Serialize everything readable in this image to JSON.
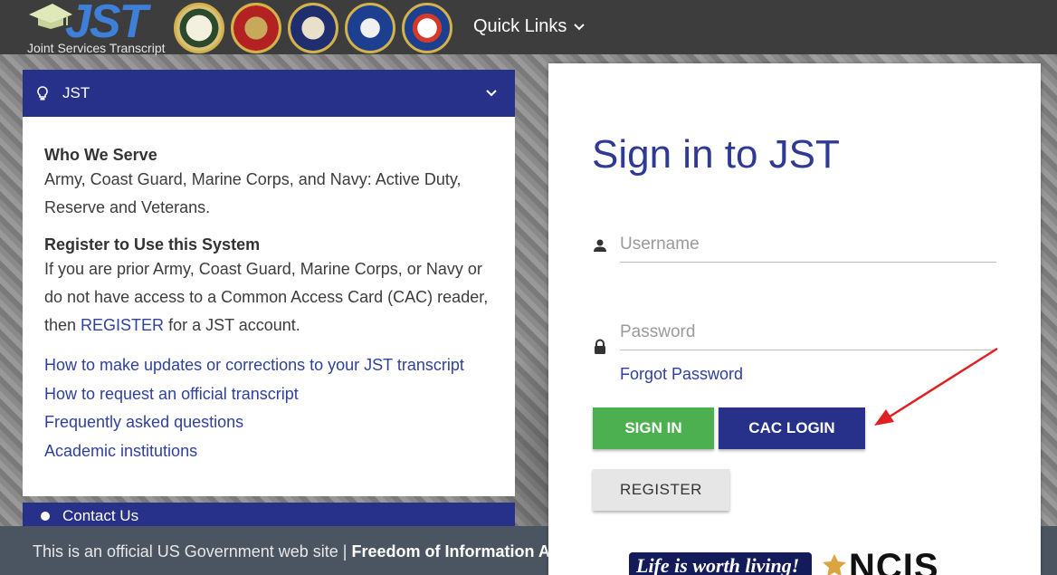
{
  "header": {
    "logo_text": "JST",
    "logo_subtitle": "Joint Services Transcript",
    "seals": [
      "army-seal",
      "marine-corps-seal",
      "navy-seal",
      "air-force-seal",
      "coast-guard-seal"
    ],
    "quick_links_label": "Quick Links"
  },
  "left_panel": {
    "title": "JST",
    "sections": [
      {
        "heading": "Who We Serve",
        "text": "Army, Coast Guard, Marine Corps, and Navy: Active Duty, Reserve and Veterans."
      },
      {
        "heading": "Register to Use this System",
        "text_before": "If you are prior Army, Coast Guard, Marine Corps, or Navy or do not have access to a Common Access Card (CAC) reader, then ",
        "link": "REGISTER",
        "text_after": " for a JST account."
      }
    ],
    "links": [
      "How to make updates or corrections to your JST transcript",
      "How to request an official transcript",
      "Frequently asked questions",
      "Academic institutions"
    ],
    "contact_title": "Contact Us"
  },
  "signin": {
    "title": "Sign in to JST",
    "username_placeholder": "Username",
    "password_placeholder": "Password",
    "forgot_password": "Forgot Password",
    "signin_button": "SIGN IN",
    "cac_button": "CAC LOGIN",
    "register_button": "REGISTER",
    "banner_text": "Life is worth living!",
    "ncis_text": "NCIS"
  },
  "footer": {
    "text": "This is an official US Government web site | ",
    "foia": "Freedom of Information Act"
  },
  "colors": {
    "header_bg": "#3d3d3d",
    "primary_navy": "#283189",
    "sign_in_green": "#4caf50",
    "link_blue": "#2f41a0",
    "annotation_arrow": "#e02020"
  }
}
